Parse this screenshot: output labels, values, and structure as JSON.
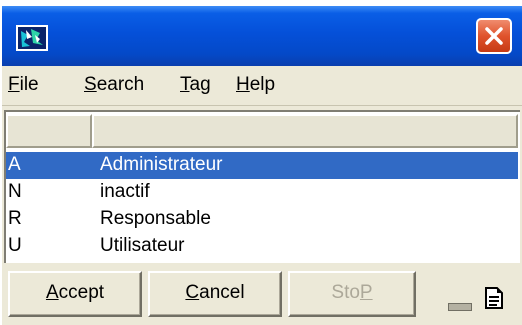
{
  "menu": {
    "items": [
      {
        "prefix": "",
        "accel": "F",
        "rest": "ile"
      },
      {
        "prefix": "",
        "accel": "S",
        "rest": "earch"
      },
      {
        "prefix": "",
        "accel": "T",
        "rest": "ag"
      },
      {
        "prefix": "",
        "accel": "H",
        "rest": "elp"
      }
    ]
  },
  "list": {
    "rows": [
      {
        "code": "A",
        "label": "Administrateur",
        "selected": true
      },
      {
        "code": "N",
        "label": "inactif",
        "selected": false
      },
      {
        "code": "R",
        "label": "Responsable",
        "selected": false
      },
      {
        "code": "U",
        "label": "Utilisateur",
        "selected": false
      }
    ]
  },
  "buttons": {
    "accept": {
      "accel": "A",
      "rest": "ccept"
    },
    "cancel": {
      "accel": "C",
      "rest": "ancel"
    },
    "stop": {
      "pre": "Sto",
      "accel": "P",
      "disabled": true
    }
  },
  "colors": {
    "title_bar": "#0550d9",
    "selection": "#316ac5",
    "close_button": "#e0532c",
    "face": "#ece9d8"
  },
  "icons": [
    "app-icon",
    "close-icon",
    "minimize-icon",
    "document-icon"
  ]
}
